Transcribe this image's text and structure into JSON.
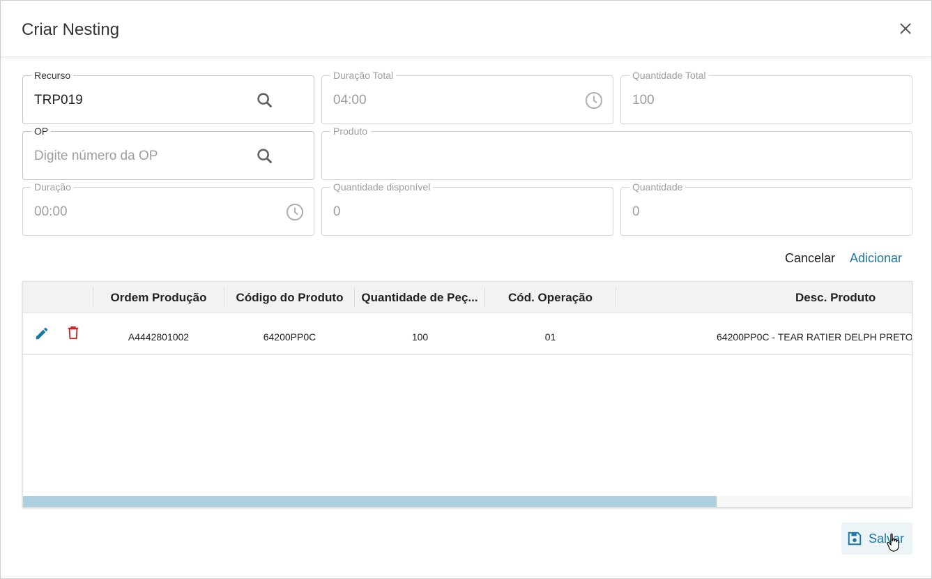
{
  "dialog": {
    "title": "Criar Nesting"
  },
  "form": {
    "recurso": {
      "label": "Recurso",
      "value": "TRP019"
    },
    "duracao_total": {
      "label": "Duração Total",
      "value": "04:00"
    },
    "quantidade_total": {
      "label": "Quantidade Total",
      "value": "100"
    },
    "op": {
      "label": "OP",
      "placeholder": "Digite número da OP",
      "value": ""
    },
    "produto": {
      "label": "Produto",
      "value": ""
    },
    "duracao": {
      "label": "Duração",
      "value": "00:00"
    },
    "quantidade_disponivel": {
      "label": "Quantidade disponível",
      "value": "0"
    },
    "quantidade": {
      "label": "Quantidade",
      "value": "0"
    }
  },
  "actions": {
    "cancel_label": "Cancelar",
    "add_label": "Adicionar",
    "save_label": "Salvar"
  },
  "table": {
    "columns": [
      "Ordem Produção",
      "Código do Produto",
      "Quantidade de Peç...",
      "Cód. Operação",
      "Desc. Produto"
    ],
    "rows": [
      {
        "ordem": "A4442801002",
        "codigo": "64200PP0C",
        "quantidade": "100",
        "operacao": "01",
        "descricao": "64200PP0C - TEAR RATIER DELPH PRETO"
      }
    ],
    "scroll_fraction": 0.78
  },
  "colors": {
    "accent": "#1a78a8",
    "danger": "#c62828",
    "scroll_thumb": "#aecfdd"
  },
  "icons": [
    "close-icon",
    "search-icon",
    "clock-icon",
    "edit-icon",
    "delete-icon",
    "save-icon"
  ]
}
